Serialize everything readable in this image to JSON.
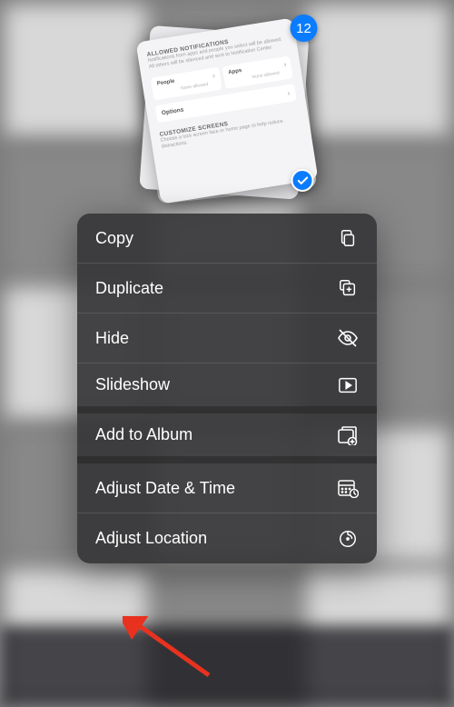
{
  "selection": {
    "count": "12",
    "preview": {
      "section1_title": "ALLOWED NOTIFICATIONS",
      "section1_sub": "Notifications from apps and people you select will be allowed. All others will be silenced and sent to Notification Center.",
      "box1_label": "People",
      "box1_sub": "None allowed",
      "box2_label": "Apps",
      "box2_sub": "None allowed",
      "option_label": "Options",
      "section2_title": "CUSTOMIZE SCREENS",
      "section2_sub": "Choose a lock screen face or home page to help reduce distractions."
    }
  },
  "menu": {
    "items": [
      {
        "label": "Copy",
        "icon": "copy-icon"
      },
      {
        "label": "Duplicate",
        "icon": "duplicate-icon"
      },
      {
        "label": "Hide",
        "icon": "hide-icon"
      },
      {
        "label": "Slideshow",
        "icon": "slideshow-icon"
      },
      {
        "label": "Add to Album",
        "icon": "add-album-icon"
      },
      {
        "label": "Adjust Date & Time",
        "icon": "calendar-icon"
      },
      {
        "label": "Adjust Location",
        "icon": "location-icon"
      }
    ]
  },
  "colors": {
    "accent": "#0a7cff",
    "menu_bg": "rgba(55,55,57,0.93)"
  }
}
